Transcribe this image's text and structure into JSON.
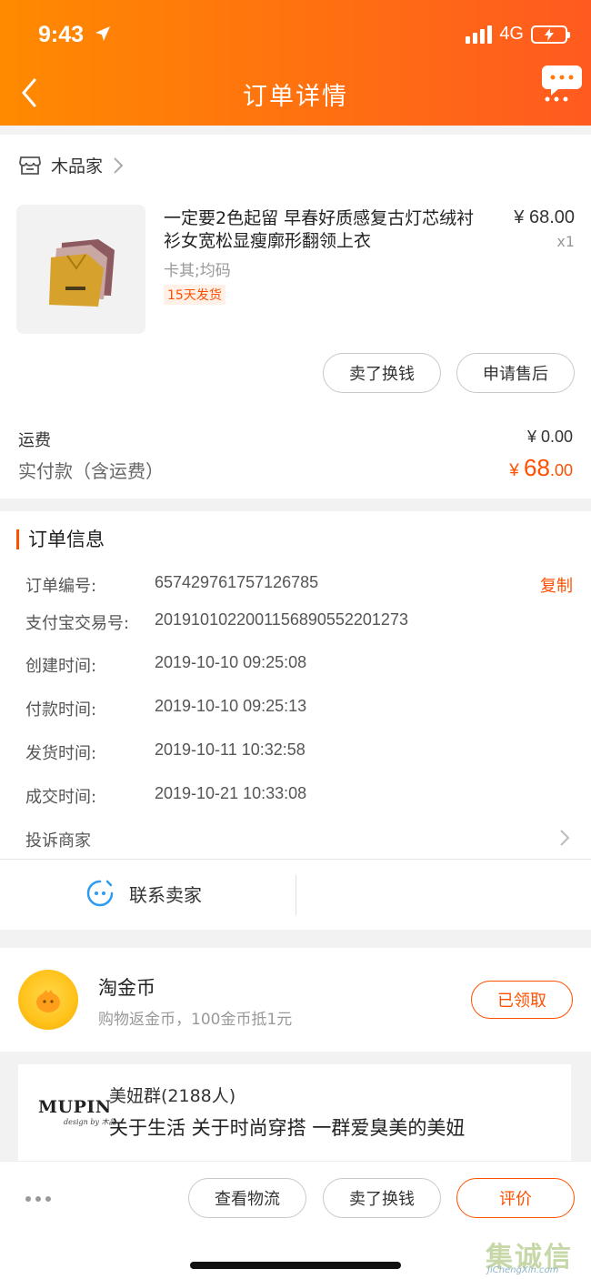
{
  "status_bar": {
    "time": "9:43",
    "network": "4G"
  },
  "header": {
    "title": "订单详情"
  },
  "shop": {
    "name": "木品家"
  },
  "product": {
    "title": "一定要2色起留 早春好质感复古灯芯绒衬衫女宽松显瘦廓形翻领上衣",
    "price": "¥ 68.00",
    "quantity": "x1",
    "sku": "卡其;均码",
    "ship_tag": "15天发货"
  },
  "item_actions": {
    "sell_label": "卖了换钱",
    "aftersale_label": "申请售后"
  },
  "fees": {
    "shipping_label": "运费",
    "shipping_value": "¥ 0.00",
    "paid_label": "实付款（含运费）",
    "paid_currency": "¥ ",
    "paid_integer": "68",
    "paid_decimal": ".00"
  },
  "order_info": {
    "title": "订单信息",
    "copy_label": "复制",
    "rows": [
      {
        "label": "订单编号:",
        "value": "657429761757126785"
      },
      {
        "label": "支付宝交易号:",
        "value": "2019101022001156890552201273"
      },
      {
        "label": "创建时间:",
        "value": "2019-10-10 09:25:08"
      },
      {
        "label": "付款时间:",
        "value": "2019-10-10 09:25:13"
      },
      {
        "label": "发货时间:",
        "value": "2019-10-11 10:32:58"
      },
      {
        "label": "成交时间:",
        "value": "2019-10-21 10:33:08"
      }
    ],
    "complain_label": "投诉商家",
    "contact_label": "联系卖家"
  },
  "coin": {
    "title": "淘金币",
    "subtitle": "购物返金币，100金币抵1元",
    "button_label": "已领取"
  },
  "group": {
    "logo_text": "MUPIN",
    "logo_sub": "design by 木品",
    "name": "美妞群(2188人)",
    "description": "关于生活 关于时尚穿搭 一群爱臭美的美妞"
  },
  "bottom_bar": {
    "logistics_label": "查看物流",
    "sell_label": "卖了换钱",
    "review_label": "评价"
  },
  "watermark": {
    "text": "集诚信",
    "url": "JiChengXin.com"
  },
  "colors": {
    "accent": "#ff5000",
    "header_start": "#ff8a00",
    "header_end": "#ff5a1f"
  }
}
